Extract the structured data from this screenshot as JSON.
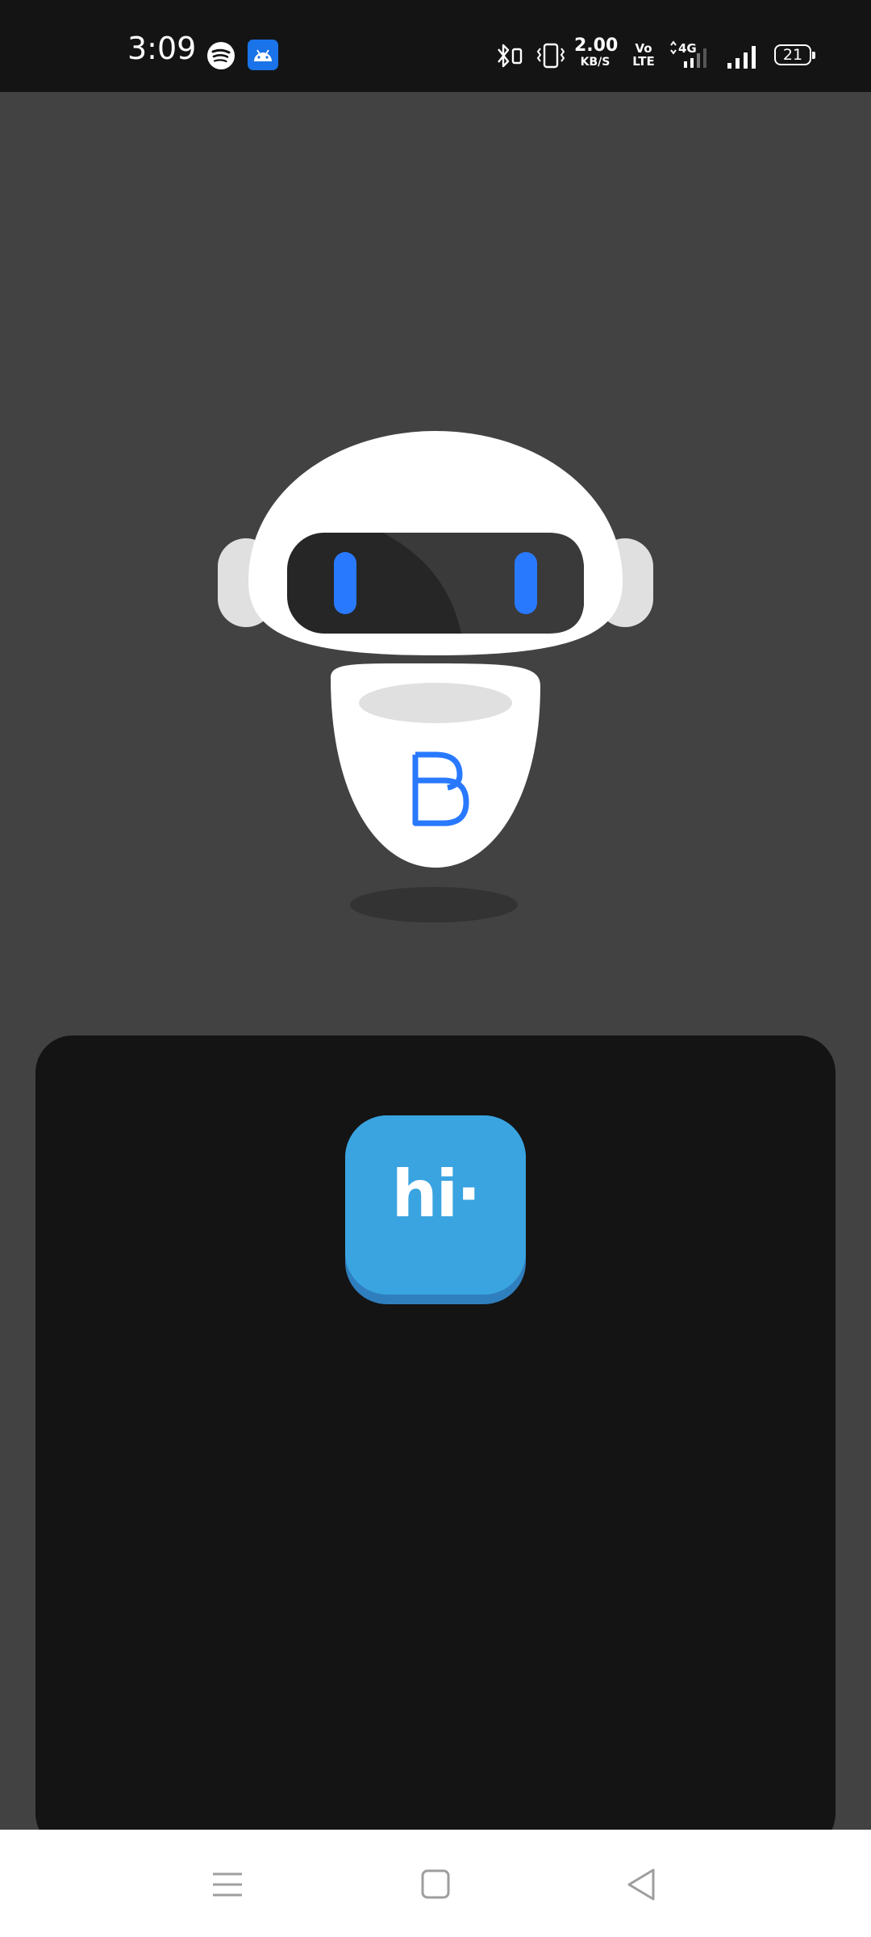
{
  "status_bar": {
    "time": "3:09",
    "net_speed_value": "2.00",
    "net_speed_unit": "KB/S",
    "volte_top": "Vo",
    "volte_bottom": "LTE",
    "network_type": "4G",
    "battery_level": "21",
    "icons": [
      "spotify-icon",
      "android-icon",
      "bluetooth-icon",
      "vibrate-icon",
      "signal-4g-icon",
      "signal-icon",
      "battery-icon"
    ]
  },
  "splash": {
    "mascot": "robot-mascot",
    "mascot_badge_letter": "B"
  },
  "app_tile": {
    "label": "hi·"
  },
  "colors": {
    "background": "#424242",
    "card": "#141414",
    "status_bar": "#141414",
    "accent_blue": "#2979ff",
    "tile_blue": "#3aa4e0"
  },
  "nav_bar": {
    "buttons": [
      "menu-icon",
      "home-icon",
      "back-icon"
    ]
  }
}
